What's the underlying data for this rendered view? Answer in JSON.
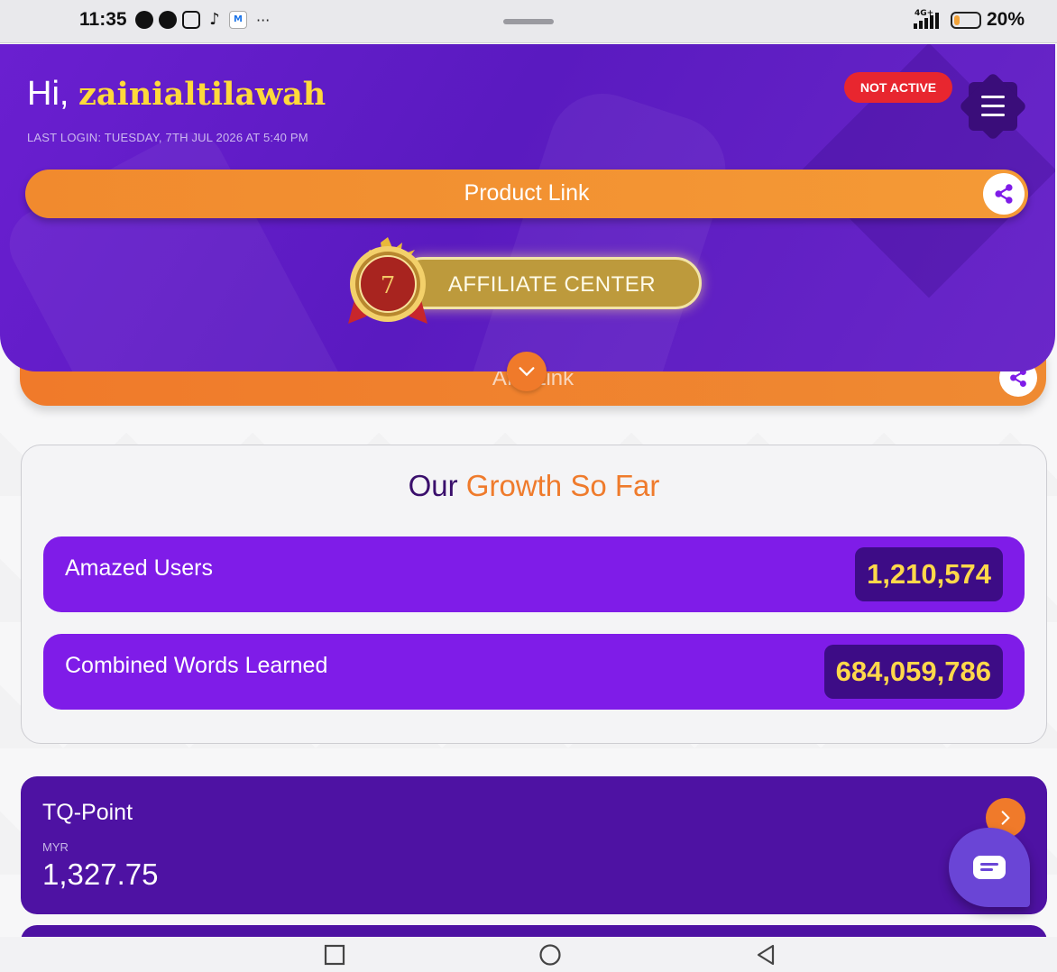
{
  "status_bar": {
    "time": "11:35",
    "network": "4G+",
    "battery_percent": "20%",
    "battery_level": 0.2,
    "more": "···",
    "app_icons": [
      "facebook-icon",
      "messenger-icon",
      "instagram-icon",
      "tiktok-icon",
      "mail-icon"
    ]
  },
  "header": {
    "greeting": "Hi, ",
    "username": "zainialtilawah",
    "last_login": "LAST LOGIN: TUESDAY, 7TH JUL 2026 AT 5:40 PM",
    "status_badge": "NOT ACTIVE",
    "product_link_label": "Product Link",
    "affiliate_label": "AFFILIATE CENTER",
    "medal_number": "7"
  },
  "behind_strip": {
    "label": "Affil     Link"
  },
  "growth": {
    "title_part1": "Our ",
    "title_part2": "Growth So Far",
    "stats": [
      {
        "label": "Amazed Users",
        "value": "1,210,574"
      },
      {
        "label": "Combined Words Learned",
        "value": "684,059,786"
      }
    ]
  },
  "tq_point": {
    "title": "TQ-Point",
    "currency": "MYR",
    "value": "1,327.75"
  },
  "colors": {
    "header_purple": "#5a1ac0",
    "accent_orange": "#f07a2a",
    "username_yellow": "#ffd93b",
    "stat_purple": "#7f1ce8",
    "badge_red": "#e8262f",
    "affiliate_gold": "#bd9a3c"
  }
}
